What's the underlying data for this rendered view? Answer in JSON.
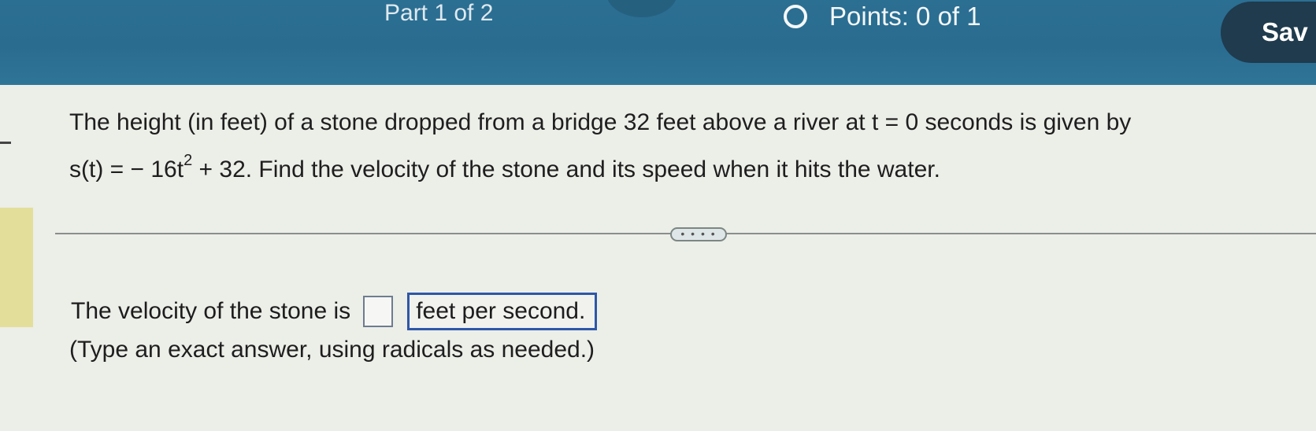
{
  "header": {
    "part_label": "Part 1 of 2",
    "points_label": "Points: 0 of 1",
    "save_label": "Sav"
  },
  "question": {
    "line1": "The height (in feet) of a stone dropped from a bridge 32 feet above a river at t = 0 seconds is given by",
    "line2_prefix": "s(t) = − 16t",
    "line2_exponent": "2",
    "line2_suffix": " + 32. Find the velocity of the stone and its speed when it hits the water."
  },
  "more_button_label": "• • • •",
  "answer": {
    "prompt": "The velocity of the stone is",
    "input_value": "",
    "unit": "feet per second.",
    "instructions": "(Type an exact answer, using radicals as needed.)"
  }
}
